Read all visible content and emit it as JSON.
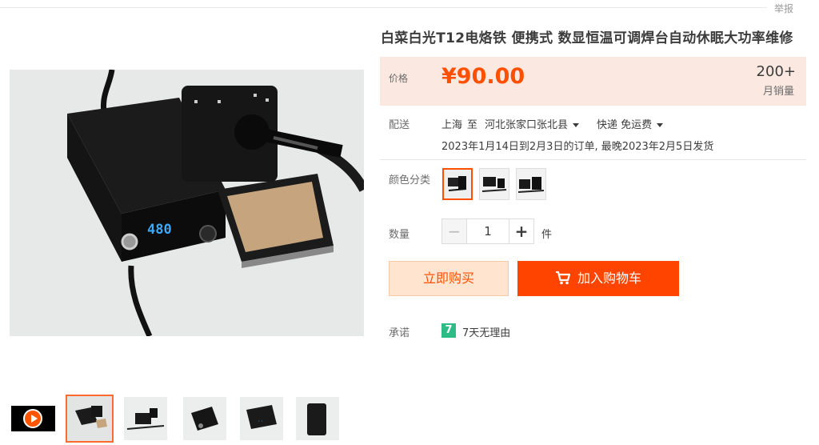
{
  "header": {
    "report_label": "举报"
  },
  "product": {
    "title": "白菜白光T12电烙铁 便携式 数显恒温可调焊台自动休眠大功率维修",
    "display_reading": "480"
  },
  "price": {
    "label": "价格",
    "value": "¥90.00",
    "sales_count": "200+",
    "sales_label": "月销量"
  },
  "delivery": {
    "label": "配送",
    "from": "上海",
    "to_word": "至",
    "destination": "河北张家口张北县",
    "shipping": "快递 免运费",
    "eta": "2023年1月14日到2月3日的订单, 最晚2023年2月5日发货"
  },
  "color": {
    "label": "颜色分类",
    "selected_index": 0,
    "option_count": 3
  },
  "quantity": {
    "label": "数量",
    "value": "1",
    "minus": "−",
    "plus": "+",
    "unit": "件"
  },
  "actions": {
    "buy_now": "立即购买",
    "add_to_cart": "加入购物车"
  },
  "promise": {
    "label": "承诺",
    "badge": "7",
    "text": "7天无理由"
  },
  "gallery": {
    "selected_index": 0,
    "thumb_count": 5,
    "has_video": true
  },
  "colors": {
    "accent": "#ff5000",
    "cart_button": "#ff4400",
    "price_bg": "#fbe8e1",
    "promise_badge": "#2dbc85"
  }
}
